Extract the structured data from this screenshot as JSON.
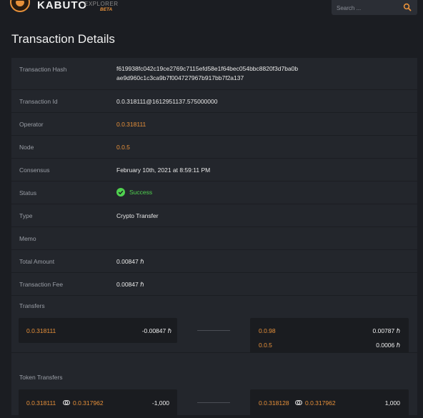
{
  "header": {
    "brand": "KABUTO",
    "explorer": "EXPLORER",
    "beta": "BETA",
    "search_placeholder": "Search ..."
  },
  "page_title": "Transaction Details",
  "details": {
    "hash_label": "Transaction Hash",
    "hash_line1": "f619938fc042c19ce2769c7115efd58e1f64bec054bbc8820f3d7ba0b",
    "hash_line2": "ae9d960c1c3ca9b7f004727967b917bb7f2a137",
    "id_label": "Transaction Id",
    "id_value": "0.0.318111@1612951137.575000000",
    "operator_label": "Operator",
    "operator_value": "0.0.318111",
    "node_label": "Node",
    "node_value": "0.0.5",
    "consensus_label": "Consensus",
    "consensus_value": "February 10th, 2021 at 8:59:11 PM",
    "status_label": "Status",
    "status_value": "Success",
    "type_label": "Type",
    "type_value": "Crypto Transfer",
    "memo_label": "Memo",
    "total_label": "Total Amount",
    "total_value": "0.00847 ℏ",
    "fee_label": "Transaction Fee",
    "fee_value": "0.00847 ℏ"
  },
  "transfers": {
    "label": "Transfers",
    "from": [
      {
        "account": "0.0.318111",
        "amount": "-0.00847 ℏ"
      }
    ],
    "to": [
      {
        "account": "0.0.98",
        "amount": "0.00787 ℏ"
      },
      {
        "account": "0.0.5",
        "amount": "0.0006 ℏ"
      }
    ]
  },
  "token_transfers": {
    "label": "Token Transfers",
    "from": [
      {
        "account": "0.0.318111",
        "token": "0.0.317962",
        "amount": "-1,000"
      }
    ],
    "to": [
      {
        "account": "0.0.318128",
        "token": "0.0.317962",
        "amount": "1,000"
      }
    ]
  },
  "colors": {
    "accent": "#e8913a",
    "success": "#4fd14f",
    "background": "#1b1d22",
    "card": "#23262c"
  },
  "icons": {
    "search": "search-icon",
    "status": "check-circle-icon",
    "token": "token-icon",
    "logo": "kabuto-logo-icon"
  }
}
